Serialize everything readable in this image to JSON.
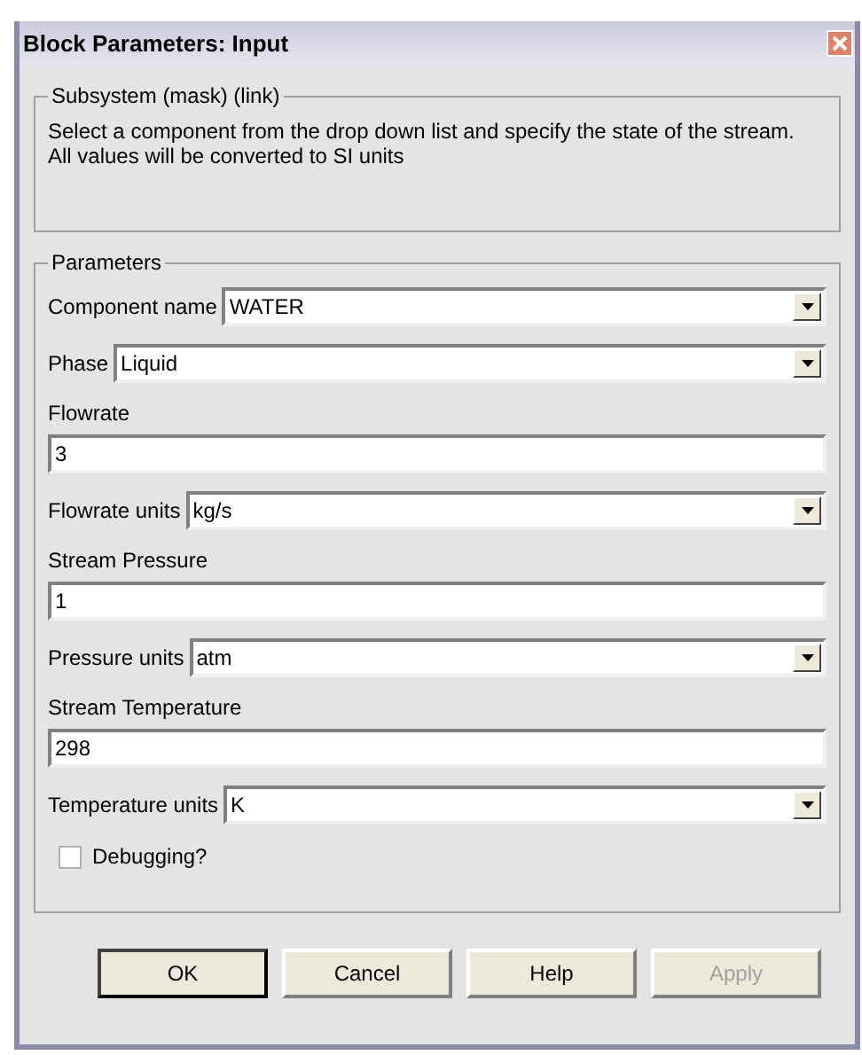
{
  "window": {
    "title": "Block Parameters: Input"
  },
  "description": {
    "title": "Subsystem (mask) (link)",
    "lines": [
      "Select a component from the drop down list and specify the state of the stream.",
      "All values will be converted to SI units"
    ]
  },
  "parameters": {
    "title": "Parameters",
    "fields": [
      {
        "kind": "select",
        "label": "Component name",
        "value": "WATER"
      },
      {
        "kind": "select",
        "label": "Phase",
        "value": "Liquid"
      },
      {
        "kind": "text",
        "label": "Flowrate",
        "value": "3"
      },
      {
        "kind": "select",
        "label": "Flowrate units",
        "value": "kg/s"
      },
      {
        "kind": "text",
        "label": "Stream Pressure",
        "value": "1"
      },
      {
        "kind": "select",
        "label": "Pressure units",
        "value": "atm"
      },
      {
        "kind": "text",
        "label": "Stream Temperature",
        "value": "298"
      },
      {
        "kind": "select",
        "label": "Temperature units",
        "value": "K"
      },
      {
        "kind": "checkbox",
        "label": "Debugging?",
        "checked": false
      }
    ]
  },
  "buttons": [
    {
      "label": "OK",
      "default": true,
      "disabled": false
    },
    {
      "label": "Cancel",
      "default": false,
      "disabled": false
    },
    {
      "label": "Help",
      "default": false,
      "disabled": false
    },
    {
      "label": "Apply",
      "default": false,
      "disabled": true
    }
  ]
}
